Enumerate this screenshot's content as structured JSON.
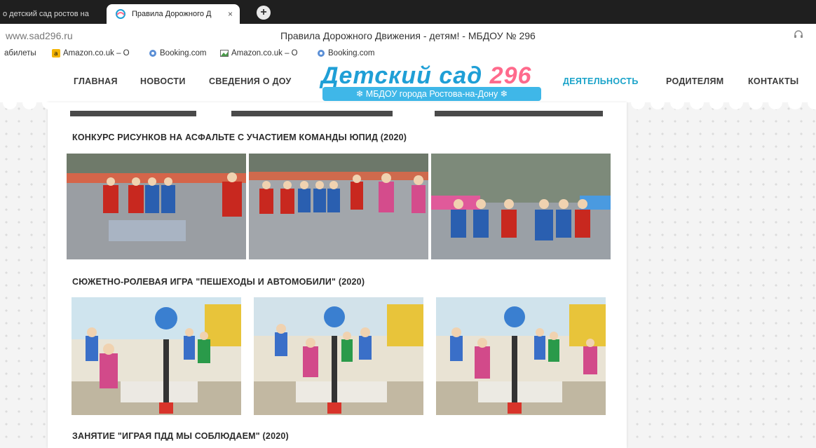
{
  "browser": {
    "tabs": [
      {
        "label": "о детский сад ростов на",
        "active": false
      },
      {
        "label": "Правила Дорожного Д",
        "active": true
      }
    ],
    "close_glyph": "×",
    "new_tab_glyph": "+",
    "url": "www.sad296.ru",
    "page_title": "Правила Дорожного Движения - детям! - МБДОУ № 296",
    "headset_icon": "headset-icon",
    "bookmarks": [
      {
        "label": "абилеты",
        "icon": ""
      },
      {
        "label": "Amazon.co.uk – O",
        "icon": "amazon-icon"
      },
      {
        "label": "Booking.com",
        "icon": "globe-icon"
      },
      {
        "label": "Amazon.co.uk – O",
        "icon": "image-icon"
      },
      {
        "label": "Booking.com",
        "icon": "globe-icon"
      }
    ]
  },
  "site": {
    "nav_left": [
      "ГЛАВНАЯ",
      "НОВОСТИ",
      "СВЕДЕНИЯ О ДОУ"
    ],
    "nav_right": [
      "ДЕЯТЕЛЬНОСТЬ",
      "РОДИТЕЛЯМ",
      "КОНТАКТЫ"
    ],
    "logo_title_text": "Детский сад ",
    "logo_title_number": "296",
    "logo_subtitle": "❄ МБДОУ города Ростова-на-Дону ❄",
    "accent_color": "#1aa3c9",
    "logo_number_color": "#ff6a8c"
  },
  "sections": [
    {
      "title": "КОНКУРС РИСУНКОВ НА АСФАЛЬТЕ С УЧАСТИЕМ КОМАНДЫ ЮПИД (2020)"
    },
    {
      "title": "СЮЖЕТНО-РОЛЕВАЯ ИГРА \"ПЕШЕХОДЫ И АВТОМОБИЛИ\" (2020)"
    },
    {
      "title": "ЗАНЯТИЕ \"ИГРАЯ ПДД МЫ СОБЛЮДАЕМ\" (2020)"
    }
  ]
}
